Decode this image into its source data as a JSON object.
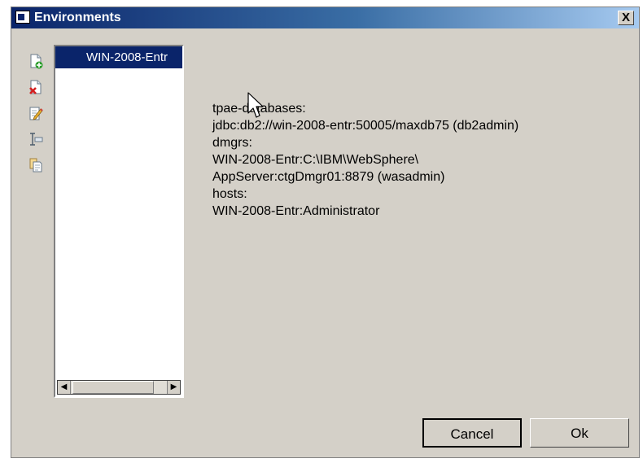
{
  "window": {
    "title": "Environments",
    "close_label": "X"
  },
  "toolbar": {
    "icons": [
      "add-environment-icon",
      "delete-environment-icon",
      "edit-environment-icon",
      "rename-environment-icon",
      "copy-environment-icon"
    ]
  },
  "environment_list": {
    "items": [
      {
        "label": "WIN-2008-Entr",
        "selected": true
      }
    ]
  },
  "details": {
    "lines": [
      "tpae-databases:",
      "jdbc:db2://win-2008-entr:50005/maxdb75 (db2admin)",
      "dmgrs:",
      "WIN-2008-Entr:C:\\IBM\\WebSphere\\",
      "AppServer:ctgDmgr01:8879 (wasadmin)",
      "hosts:",
      "WIN-2008-Entr:Administrator"
    ]
  },
  "buttons": {
    "cancel": "Cancel",
    "ok": "Ok"
  },
  "colors": {
    "selection": "#0a246a",
    "dialog_bg": "#d4d0c8",
    "title_gradient_start": "#0a246a",
    "title_gradient_end": "#a6caf0"
  }
}
